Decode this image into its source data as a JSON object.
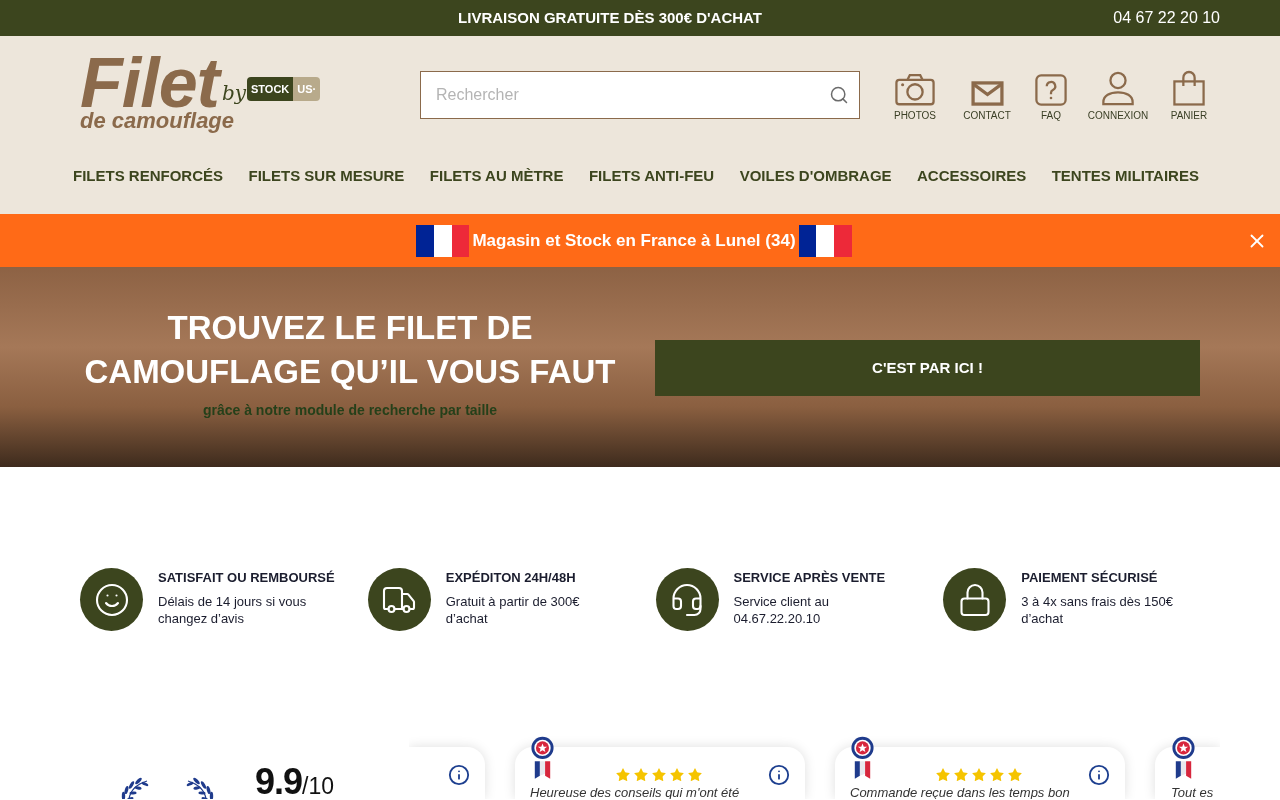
{
  "top_bar": {
    "announcement": "LIVRAISON GRATUITE DÈS 300€ D'ACHAT",
    "phone": "04 67 22 20 10"
  },
  "logo": {
    "title": "Filet",
    "by": "by",
    "badge_left": "STOCK",
    "badge_right": "US·",
    "subtitle": "de camouflage"
  },
  "search": {
    "placeholder": "Rechercher"
  },
  "header_links": [
    {
      "label": "PHOTOS"
    },
    {
      "label": "CONTACT"
    },
    {
      "label": "FAQ"
    },
    {
      "label": "CONNEXION"
    },
    {
      "label": "PANIER"
    }
  ],
  "nav": [
    {
      "label": "FILETS RENFORCÉS"
    },
    {
      "label": "FILETS SUR MESURE"
    },
    {
      "label": "FILETS AU MÈTRE"
    },
    {
      "label": "FILETS ANTI-FEU"
    },
    {
      "label": "VOILES D'OMBRAGE"
    },
    {
      "label": "ACCESSOIRES"
    },
    {
      "label": "TENTES MILITAIRES"
    }
  ],
  "notice": {
    "text": "Magasin et Stock en France à Lunel (34)"
  },
  "hero": {
    "title_lines": [
      "TROUVEZ LE FILET DE",
      "CAMOUFLAGE QU’IL VOUS FAUT"
    ],
    "subtitle": "grâce à notre module de recherche par taille",
    "button": "C'EST PAR ICI !"
  },
  "features": [
    {
      "title": "SATISFAIT OU REMBOURSÉ",
      "text": "Délais de 14 jours si vous changez d’avis"
    },
    {
      "title": "EXPÉDITON 24H/48H",
      "text": "Gratuit à partir de 300€ d’achat"
    },
    {
      "title": "SERVICE APRÈS VENTE",
      "text": "Service client au 04.67.22.20.10"
    },
    {
      "title": "PAIEMENT SÉCURISÉ",
      "text": "3 à 4x sans frais dès 150€ d’achat"
    }
  ],
  "rating": {
    "score": "9.9",
    "scale": "/10"
  },
  "reviews": [
    {
      "medal": false,
      "info": true
    },
    {
      "medal": true,
      "stars": 5,
      "info": true,
      "text": "Heureuse des conseils qui m'ont été"
    },
    {
      "medal": true,
      "stars": 5,
      "info": true,
      "text": "Commande reçue dans les temps bon"
    },
    {
      "medal": true,
      "info": false,
      "text": "Tout es"
    }
  ]
}
